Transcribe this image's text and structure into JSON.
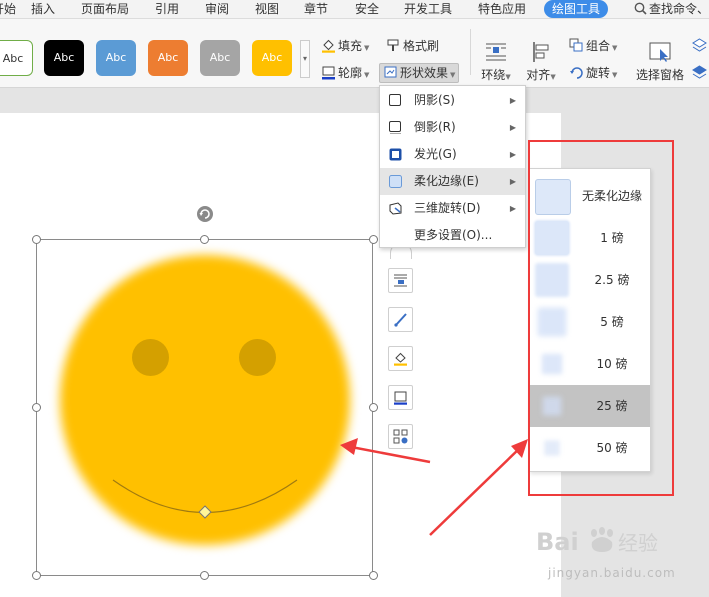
{
  "menubar": {
    "tabs": [
      "开始",
      "插入",
      "页面布局",
      "引用",
      "审阅",
      "视图",
      "章节",
      "安全",
      "开发工具",
      "特色应用",
      "绘图工具"
    ],
    "search": "查找命令、"
  },
  "ribbon": {
    "style_swatches": [
      "Abc",
      "Abc",
      "Abc",
      "Abc",
      "Abc",
      "Abc"
    ],
    "fill": "填充",
    "format_painter": "格式刷",
    "outline": "轮廓",
    "shape_effects": "形状效果",
    "wrap": "环绕",
    "align": "对齐",
    "group": "组合",
    "rotate": "旋转",
    "selection_pane": "选择窗格"
  },
  "effects_menu": {
    "items": [
      {
        "label": "阴影(S)",
        "icon": "shadow-icon",
        "has_submenu": true
      },
      {
        "label": "倒影(R)",
        "icon": "reflection-icon",
        "has_submenu": true
      },
      {
        "label": "发光(G)",
        "icon": "glow-icon",
        "has_submenu": true
      },
      {
        "label": "柔化边缘(E)",
        "icon": "soft-edges-icon",
        "has_submenu": true,
        "highlighted": true
      },
      {
        "label": "三维旋转(D)",
        "icon": "3d-rotation-icon",
        "has_submenu": true
      },
      {
        "label": "更多设置(O)...",
        "icon": "",
        "has_submenu": false
      }
    ]
  },
  "soft_edges_submenu": {
    "options": [
      {
        "label": "无柔化边缘",
        "blur": 0
      },
      {
        "label": "1 磅",
        "blur": 1
      },
      {
        "label": "2.5 磅",
        "blur": 2.5
      },
      {
        "label": "5 磅",
        "blur": 5
      },
      {
        "label": "10 磅",
        "blur": 10
      },
      {
        "label": "25 磅",
        "blur": 25,
        "highlighted": true
      },
      {
        "label": "50 磅",
        "blur": 50
      }
    ]
  },
  "watermark": {
    "text": "jingyan.baidu.com",
    "logo": "Bai经验"
  },
  "colors": {
    "accent": "#3d8ce8",
    "smiley": "#ffc000",
    "highlight_frame": "#ee3b3b",
    "arrow": "#ee3b3b"
  }
}
